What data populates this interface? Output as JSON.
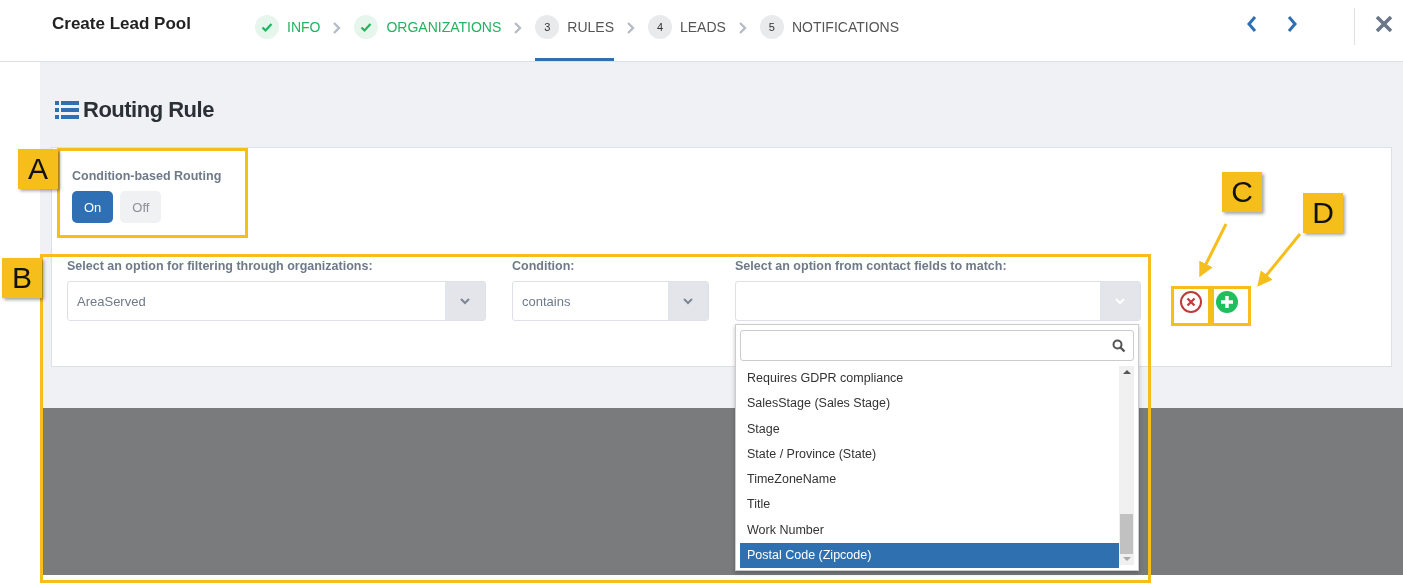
{
  "header": {
    "title": "Create Lead Pool",
    "steps": [
      {
        "label": "INFO",
        "completed": true,
        "selected": false
      },
      {
        "label": "ORGANIZATIONS",
        "completed": true,
        "selected": false
      },
      {
        "number": "3",
        "label": "RULES",
        "completed": false,
        "selected": true
      },
      {
        "number": "4",
        "label": "LEADS",
        "completed": false,
        "selected": false
      },
      {
        "number": "5",
        "label": "NOTIFICATIONS",
        "completed": false,
        "selected": false
      }
    ]
  },
  "section_title": "Routing Rule",
  "routing_toggle": {
    "label": "Condition-based Routing",
    "options": [
      {
        "label": "On",
        "selected": true
      },
      {
        "label": "Off",
        "selected": false
      }
    ]
  },
  "filters": [
    {
      "label": "Select an option for filtering through organizations:",
      "value": "AreaServed"
    },
    {
      "label": "Condition:",
      "value": "contains"
    },
    {
      "label": "Select an option from contact fields to match:"
    }
  ],
  "dropdown": {
    "options": [
      {
        "label": "Requires GDPR compliance",
        "selected": false
      },
      {
        "label": "SalesStage (Sales Stage)",
        "selected": false
      },
      {
        "label": "Stage",
        "selected": false
      },
      {
        "label": "State / Province (State)",
        "selected": false
      },
      {
        "label": "TimeZoneName",
        "selected": false
      },
      {
        "label": "Title",
        "selected": false
      },
      {
        "label": "Work Number",
        "selected": false
      },
      {
        "label": "Postal Code (Zipcode)",
        "selected": true
      }
    ]
  },
  "annotations": [
    "A",
    "B",
    "C",
    "D"
  ]
}
